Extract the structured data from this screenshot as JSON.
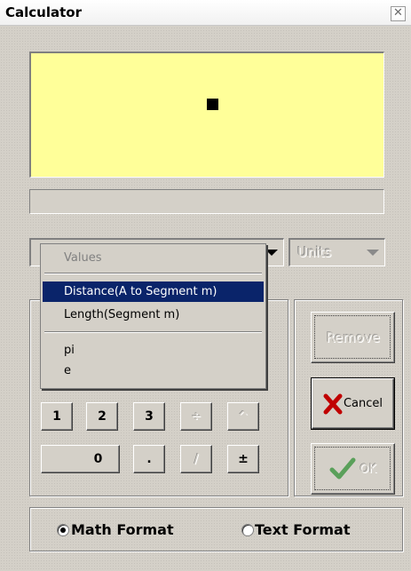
{
  "window": {
    "title": "Calculator",
    "close_glyph": "✕"
  },
  "display": {
    "expression": ""
  },
  "status": {
    "text": ""
  },
  "values_combo": {
    "selected": ""
  },
  "units_combo": {
    "label": "Units"
  },
  "dropdown": {
    "header": "Values",
    "items": [
      {
        "label": "Distance(A to Segment m)",
        "selected": true
      },
      {
        "label": "Length(Segment m)",
        "selected": false
      },
      {
        "label": "pi",
        "selected": false
      },
      {
        "label": "e",
        "selected": false
      }
    ]
  },
  "keypad": {
    "row1": [
      "1",
      "2",
      "3",
      "÷",
      "^"
    ],
    "row2": [
      "0",
      ".",
      "/",
      "±"
    ]
  },
  "actions": {
    "remove_label": "Remove",
    "cancel_label": "Cancel",
    "ok_label": "OK"
  },
  "format": {
    "math_label": "Math Format",
    "text_label": "Text Format",
    "selected": "math"
  },
  "colors": {
    "display_bg": "#ffff99",
    "selection": "#0a246a",
    "cancel_x": "#c00000",
    "ok_check": "#3a8a3a"
  }
}
